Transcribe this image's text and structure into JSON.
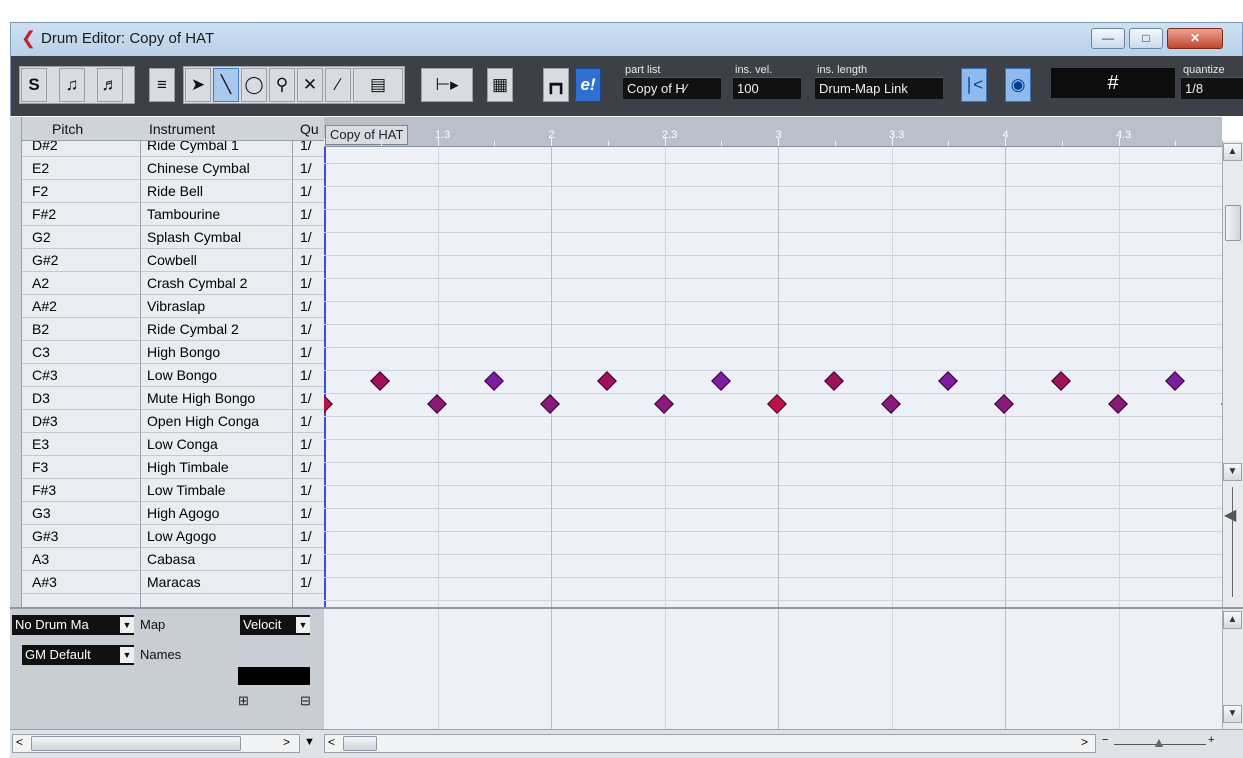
{
  "window": {
    "title": "Drum Editor: Copy of HAT"
  },
  "toolbar": {
    "solo_label": "S",
    "part_list": {
      "label": "part list",
      "value": "Copy of H⁄"
    },
    "ins_vel": {
      "label": "ins. vel.",
      "value": "100"
    },
    "ins_length": {
      "label": "ins. length",
      "value": "Drum-Map Link"
    },
    "grid_symbol": "#",
    "quantize": {
      "label": "quantize",
      "value": "1/8"
    },
    "accent_color": "#2f6fcf"
  },
  "list": {
    "headers": [
      "Pitch",
      "Instrument",
      "Qu"
    ],
    "rows": [
      {
        "pitch": "D#2",
        "instrument": "Ride Cymbal 1",
        "q": "1/"
      },
      {
        "pitch": "E2",
        "instrument": "Chinese Cymbal",
        "q": "1/"
      },
      {
        "pitch": "F2",
        "instrument": "Ride Bell",
        "q": "1/"
      },
      {
        "pitch": "F#2",
        "instrument": "Tambourine",
        "q": "1/"
      },
      {
        "pitch": "G2",
        "instrument": "Splash Cymbal",
        "q": "1/"
      },
      {
        "pitch": "G#2",
        "instrument": "Cowbell",
        "q": "1/"
      },
      {
        "pitch": "A2",
        "instrument": "Crash Cymbal 2",
        "q": "1/"
      },
      {
        "pitch": "A#2",
        "instrument": "Vibraslap",
        "q": "1/"
      },
      {
        "pitch": "B2",
        "instrument": "Ride Cymbal 2",
        "q": "1/"
      },
      {
        "pitch": "C3",
        "instrument": "High Bongo",
        "q": "1/"
      },
      {
        "pitch": "C#3",
        "instrument": "Low Bongo",
        "q": "1/"
      },
      {
        "pitch": "D3",
        "instrument": "Mute High Bongo",
        "q": "1/"
      },
      {
        "pitch": "D#3",
        "instrument": "Open High Conga",
        "q": "1/"
      },
      {
        "pitch": "E3",
        "instrument": "Low Conga",
        "q": "1/"
      },
      {
        "pitch": "F3",
        "instrument": "High Timbale",
        "q": "1/"
      },
      {
        "pitch": "F#3",
        "instrument": "Low Timbale",
        "q": "1/"
      },
      {
        "pitch": "G3",
        "instrument": "High Agogo",
        "q": "1/"
      },
      {
        "pitch": "G#3",
        "instrument": "Low Agogo",
        "q": "1/"
      },
      {
        "pitch": "A3",
        "instrument": "Cabasa",
        "q": "1/"
      },
      {
        "pitch": "A#3",
        "instrument": "Maracas",
        "q": "1/"
      }
    ]
  },
  "ruler": {
    "part_name": "Copy of HAT",
    "ticks": [
      "1.3",
      "2",
      "2.3",
      "3",
      "3.3",
      "4",
      "4.3"
    ]
  },
  "notes": {
    "low_bongo_color": "#8a1a7a",
    "mute_high_bongo_color": "#a0125a"
  },
  "lower": {
    "drum_map": "No Drum Ma",
    "map_label": "Map",
    "controller": "Velocit",
    "name_map": "GM Default",
    "names_label": "Names"
  }
}
